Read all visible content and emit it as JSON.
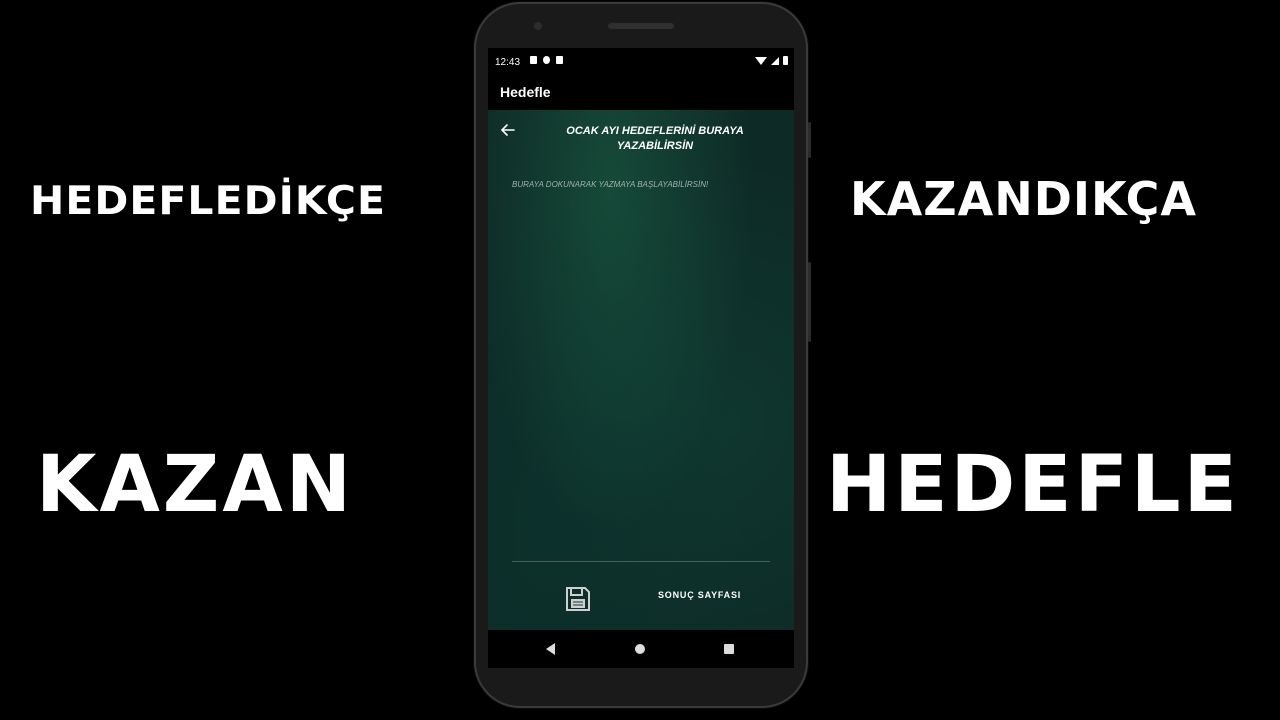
{
  "promo": {
    "top_left": "HEDEFLEDİKÇE",
    "top_right": "KAZANDIKÇA",
    "bottom_left": "KAZAN",
    "bottom_right": "HEDEFLE"
  },
  "status_bar": {
    "time": "12:43"
  },
  "app_bar": {
    "title": "Hedefle"
  },
  "screen": {
    "heading": "OCAK AYI HEDEFLERİNİ BURAYA YAZABİLİRSİN",
    "input_placeholder": "BURAYA DOKUNARAK YAZMAYA BAŞLAYABİLİRSİN!",
    "input_value": "",
    "result_button_label": "SONUÇ SAYFASI"
  },
  "icons": {
    "back": "arrow-left-icon",
    "save": "floppy-disk-icon",
    "nav_back": "triangle-back-icon",
    "nav_home": "circle-home-icon",
    "nav_recent": "square-recents-icon"
  },
  "colors": {
    "background": "#000000",
    "content_green": "#0e2a26",
    "text": "#ffffff"
  }
}
